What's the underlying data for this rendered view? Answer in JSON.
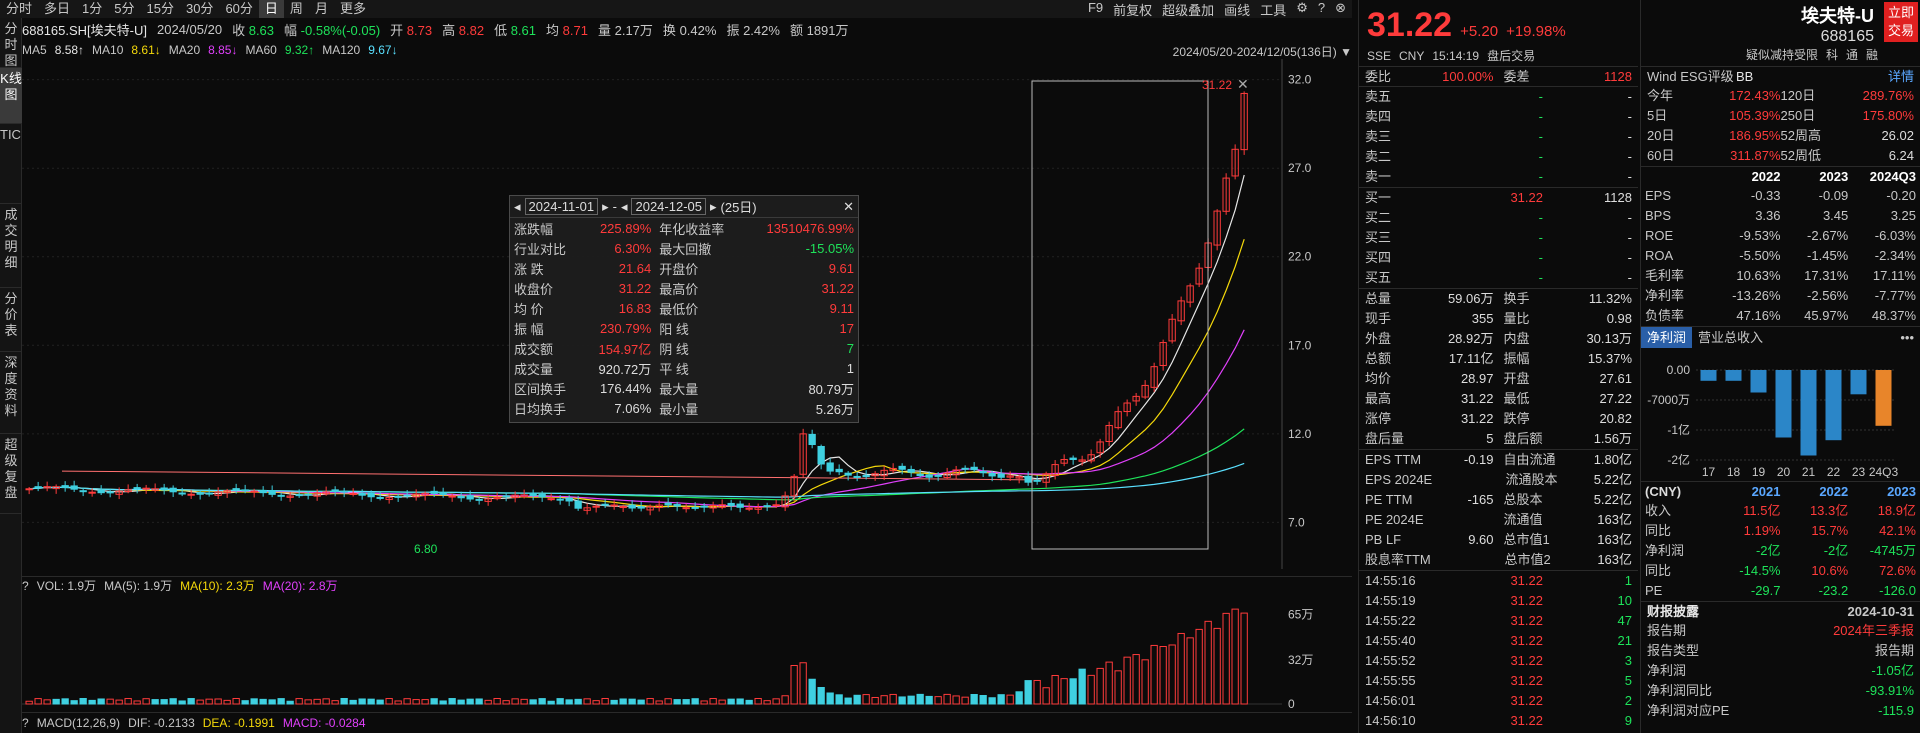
{
  "topbar": {
    "tabs": [
      "分时",
      "多日",
      "1分",
      "5分",
      "15分",
      "30分",
      "60分",
      "日",
      "周",
      "月",
      "更多"
    ],
    "active": "日",
    "right": [
      "F9",
      "前复权",
      "超级叠加",
      "画线",
      "工具"
    ]
  },
  "sidebar": [
    "分时图",
    "K线图",
    "TICK",
    "成交明细",
    "分价表",
    "深度资料",
    "超级复盘"
  ],
  "info": {
    "code": "688165.SH[埃夫特-U]",
    "date": "2024/05/20",
    "close_label": "收",
    "close": "8.63",
    "chg_label": "幅",
    "chg": "-0.58%(-0.05)",
    "open_label": "开",
    "open": "8.73",
    "high_label": "高",
    "high": "8.82",
    "low_label": "低",
    "low": "8.61",
    "avg_label": "均",
    "avg": "8.71",
    "vol_label": "量",
    "vol": "2.17万",
    "turn_label": "换",
    "turn": "0.42%",
    "amp_label": "振",
    "amp": "2.42%",
    "amt_label": "额",
    "amt": "1891万"
  },
  "ma": {
    "ma5": "MA5",
    "ma5v": "8.58↑",
    "ma10": "MA10",
    "ma10v": "8.61↓",
    "ma20": "MA20",
    "ma20v": "8.85↓",
    "ma60": "MA60",
    "ma60v": "9.32↑",
    "ma120": "MA120",
    "ma120v": "9.67↓"
  },
  "range": "2024/05/20-2024/12/05(136日)",
  "colors": {
    "ma5": "#e6e6e6",
    "ma10": "#f5d90a",
    "ma20": "#e040fb",
    "ma60": "#1ee35a",
    "ma120": "#5ae0ff",
    "up": "#ff3b3b",
    "down": "#3fd0e0"
  },
  "yaxis": [
    "32.0",
    "27.0",
    "22.0",
    "17.0",
    "12.0",
    "7.0"
  ],
  "low_label": "6.80",
  "high_label": "31.22",
  "vol_axis": [
    "65万",
    "32万",
    "0"
  ],
  "tip": {
    "from": "2024-11-01",
    "to": "2024-12-05",
    "days": "(25日)",
    "rows": [
      [
        "涨跌幅",
        "225.89%",
        "年化收益率",
        "13510476.99%"
      ],
      [
        "行业对比",
        "6.30%",
        "最大回撤",
        "-15.05%"
      ],
      [
        "涨 跌",
        "21.64",
        "开盘价",
        "9.61"
      ],
      [
        "收盘价",
        "31.22",
        "最高价",
        "31.22"
      ],
      [
        "均 价",
        "16.83",
        "最低价",
        "9.11"
      ],
      [
        "振 幅",
        "230.79%",
        "阳 线",
        "17"
      ],
      [
        "成交额",
        "154.97亿",
        "阴 线",
        "7"
      ],
      [
        "成交量",
        "920.72万",
        "平 线",
        "1"
      ],
      [
        "区间换手",
        "176.44%",
        "最大量",
        "80.79万"
      ],
      [
        "日均换手",
        "7.06%",
        "最小量",
        "5.26万"
      ]
    ]
  },
  "vol": {
    "q": "?",
    "label": "VOL: 1.9万",
    "ma5": "MA(5): 1.9万",
    "ma10": "MA(10): 2.3万",
    "ma20": "MA(20): 2.8万"
  },
  "macd": {
    "q": "?",
    "label": "MACD(12,26,9)",
    "dif": "DIF: -0.2133",
    "dea": "DEA: -0.1991",
    "macd": "MACD: -0.0284"
  },
  "quote": {
    "price": "31.22",
    "chg": "+5.20",
    "pct": "+19.98%",
    "ex": "SSE",
    "cur": "CNY",
    "time": "15:14:19",
    "status": "盘后交易",
    "wb_label": "委比",
    "wb": "100.00%",
    "wc_label": "委差",
    "wc": "1128",
    "sells": [
      [
        "卖五",
        "-",
        "-"
      ],
      [
        "卖四",
        "-",
        "-"
      ],
      [
        "卖三",
        "-",
        "-"
      ],
      [
        "卖二",
        "-",
        "-"
      ],
      [
        "卖一",
        "-",
        "-"
      ]
    ],
    "buys": [
      [
        "买一",
        "31.22",
        "1128"
      ],
      [
        "买二",
        "-",
        "-"
      ],
      [
        "买三",
        "-",
        "-"
      ],
      [
        "买四",
        "-",
        "-"
      ],
      [
        "买五",
        "-",
        "-"
      ]
    ],
    "stats": [
      [
        "总量",
        "59.06万",
        "换手",
        "11.32%"
      ],
      [
        "现手",
        "355",
        "量比",
        "0.98"
      ],
      [
        "外盘",
        "28.92万",
        "内盘",
        "30.13万"
      ],
      [
        "总额",
        "17.11亿",
        "振幅",
        "15.37%"
      ],
      [
        "均价",
        "28.97",
        "开盘",
        "27.61"
      ],
      [
        "最高",
        "31.22",
        "最低",
        "27.22"
      ],
      [
        "涨停",
        "31.22",
        "跌停",
        "20.82"
      ],
      [
        "盘后量",
        "5",
        "盘后额",
        "1.56万"
      ]
    ],
    "fin": [
      [
        "EPS TTM",
        "-0.19",
        "自由流通",
        "1.80亿"
      ],
      [
        "EPS 2024E",
        "",
        "流通股本",
        "5.22亿"
      ],
      [
        "PE TTM",
        "-165",
        "总股本",
        "5.22亿"
      ],
      [
        "PE 2024E",
        "",
        "流通值",
        "163亿"
      ],
      [
        "PB LF",
        "9.60",
        "总市值1",
        "163亿"
      ],
      [
        "股息率TTM",
        "",
        "总市值2",
        "163亿"
      ]
    ],
    "ticks": [
      [
        "14:55:16",
        "31.22",
        "1"
      ],
      [
        "14:55:19",
        "31.22",
        "10"
      ],
      [
        "14:55:22",
        "31.22",
        "47"
      ],
      [
        "14:55:40",
        "31.22",
        "21"
      ],
      [
        "14:55:52",
        "31.22",
        "3"
      ],
      [
        "14:55:55",
        "31.22",
        "5"
      ],
      [
        "14:56:01",
        "31.22",
        "2"
      ],
      [
        "14:56:10",
        "31.22",
        "9"
      ]
    ]
  },
  "fund": {
    "name": "埃夫特-U",
    "code": "688165",
    "btn": "立即交易",
    "tag": "疑似减持受限",
    "tags": [
      "科",
      "通",
      "融"
    ],
    "esg_label": "Wind ESG评级",
    "esg": "BB",
    "detail": "详情",
    "perf": [
      [
        "今年",
        "172.43%",
        "120日",
        "289.76%"
      ],
      [
        "5日",
        "105.39%",
        "250日",
        "175.80%"
      ],
      [
        "20日",
        "186.95%",
        "52周高",
        "26.02"
      ],
      [
        "60日",
        "311.87%",
        "52周低",
        "6.24"
      ]
    ],
    "yrs": [
      "2022",
      "2023",
      "2024Q3"
    ],
    "metrics": [
      [
        "EPS",
        "-0.33",
        "-0.09",
        "-0.20"
      ],
      [
        "BPS",
        "3.36",
        "3.45",
        "3.25"
      ],
      [
        "ROE",
        "-9.53%",
        "-2.67%",
        "-6.03%"
      ],
      [
        "ROA",
        "-5.50%",
        "-1.45%",
        "-2.34%"
      ],
      [
        "毛利率",
        "10.63%",
        "17.31%",
        "17.11%"
      ],
      [
        "净利率",
        "-13.26%",
        "-2.56%",
        "-7.77%"
      ],
      [
        "负债率",
        "47.16%",
        "45.97%",
        "48.37%"
      ]
    ],
    "tabs": [
      "净利润",
      "营业总收入"
    ],
    "bar_axis": [
      "0.00",
      "-7000万",
      "-1亿",
      "-2亿"
    ],
    "bar_x": [
      "17",
      "18",
      "19",
      "20",
      "21",
      "22",
      "23",
      "24Q3"
    ],
    "bar_values": [
      -0.12,
      -0.12,
      -0.25,
      -0.75,
      -0.95,
      -0.78,
      -0.27,
      -0.62
    ],
    "ann_unit": "(CNY)",
    "ann_yrs": [
      "2021",
      "2022",
      "2023"
    ],
    "ann": [
      [
        "收入",
        "11.5亿",
        "13.3亿",
        "18.9亿"
      ],
      [
        "同比",
        "1.19%",
        "15.7%",
        "42.1%"
      ],
      [
        "净利润",
        "-2亿",
        "-2亿",
        "-4745万"
      ],
      [
        "同比",
        "-14.5%",
        "10.6%",
        "72.6%"
      ],
      [
        "PE",
        "-29.7",
        "-23.2",
        "-126.0"
      ]
    ],
    "report_title": "财报披露",
    "report_date": "2024-10-31",
    "report": [
      [
        "报告期",
        "2024年三季报"
      ],
      [
        "报告类型",
        "报告期"
      ],
      [
        "净利润",
        "-1.05亿"
      ],
      [
        "净利润同比",
        "-93.91%"
      ],
      [
        "净利润对应PE",
        "-115.9"
      ]
    ]
  }
}
